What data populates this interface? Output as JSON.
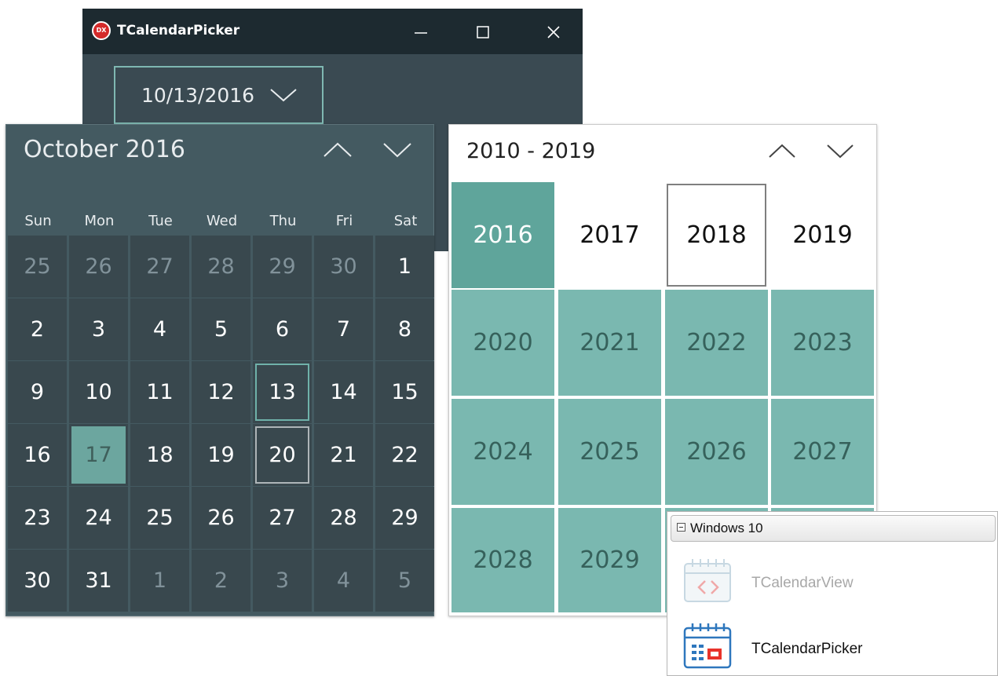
{
  "window": {
    "title": "TCalendarPicker",
    "app_icon": "DX",
    "date_value": "10/13/2016"
  },
  "month_calendar": {
    "header": "October 2016",
    "weekdays": [
      "Sun",
      "Mon",
      "Tue",
      "Wed",
      "Thu",
      "Fri",
      "Sat"
    ],
    "days": [
      [
        "25",
        "26",
        "27",
        "28",
        "29",
        "30",
        "1"
      ],
      [
        "2",
        "3",
        "4",
        "5",
        "6",
        "7",
        "8"
      ],
      [
        "9",
        "10",
        "11",
        "12",
        "13",
        "14",
        "15"
      ],
      [
        "16",
        "17",
        "18",
        "19",
        "20",
        "21",
        "22"
      ],
      [
        "23",
        "24",
        "25",
        "26",
        "27",
        "28",
        "29"
      ],
      [
        "30",
        "31",
        "1",
        "2",
        "3",
        "4",
        "5"
      ]
    ],
    "today": "13",
    "selected": "17",
    "hovered": "20"
  },
  "decade_calendar": {
    "header": "2010 - 2019",
    "years": [
      [
        "2016",
        "2017",
        "2018",
        "2019"
      ],
      [
        "2020",
        "2021",
        "2022",
        "2023"
      ],
      [
        "2024",
        "2025",
        "2026",
        "2027"
      ],
      [
        "2028",
        "2029",
        "",
        ""
      ]
    ],
    "current": "2016",
    "outlined": "2018"
  },
  "palette": {
    "category": "Windows 10",
    "items": [
      {
        "label": "TCalendarView",
        "enabled": false
      },
      {
        "label": "TCalendarPicker",
        "enabled": true
      }
    ]
  },
  "colors": {
    "accent": "#6fb2aa",
    "dark_bg": "#39484e",
    "teal": "#7ab8b0"
  }
}
